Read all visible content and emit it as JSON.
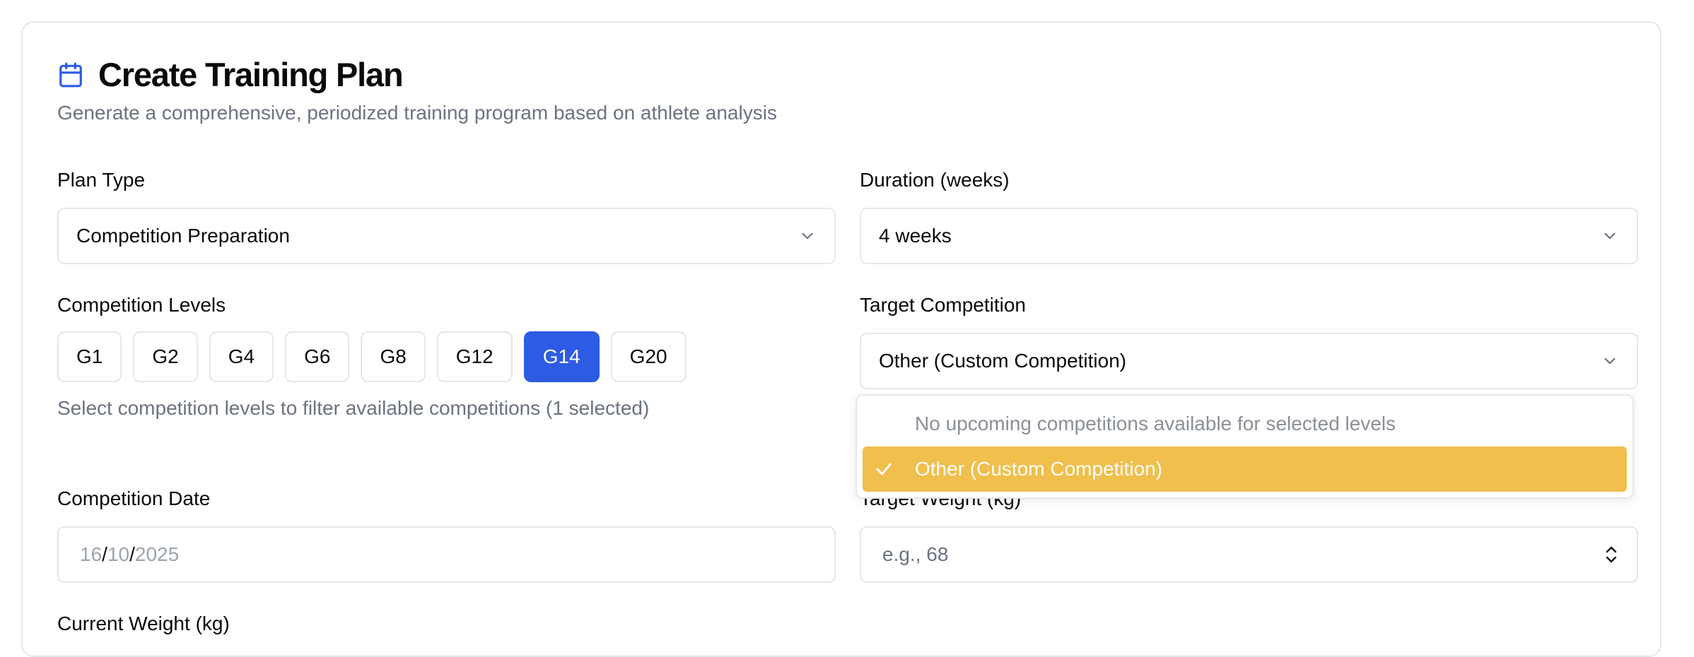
{
  "header": {
    "title": "Create Training Plan",
    "subtitle": "Generate a comprehensive, periodized training program based on athlete analysis",
    "icon": "calendar-icon",
    "accent_color": "#2d5be3"
  },
  "plan_type": {
    "label": "Plan Type",
    "value": "Competition Preparation"
  },
  "duration": {
    "label": "Duration (weeks)",
    "value": "4 weeks"
  },
  "competition_levels": {
    "label": "Competition Levels",
    "options": [
      "G1",
      "G2",
      "G4",
      "G6",
      "G8",
      "G12",
      "G14",
      "G20"
    ],
    "selected": "G14",
    "hint": "Select competition levels to filter available competitions (1 selected)"
  },
  "target_competition": {
    "label": "Target Competition",
    "value": "Other (Custom Competition)",
    "dropdown": {
      "empty_message": "No upcoming competitions available for selected levels",
      "selected_option": "Other (Custom Competition)",
      "highlight_color": "#f0bf4c"
    }
  },
  "competition_date": {
    "label": "Competition Date",
    "day": "16",
    "month": "10",
    "year": "2025",
    "separator": "/"
  },
  "target_weight": {
    "label": "Target Weight (kg)",
    "placeholder": "e.g., 68"
  },
  "current_weight": {
    "label": "Current Weight (kg)"
  }
}
